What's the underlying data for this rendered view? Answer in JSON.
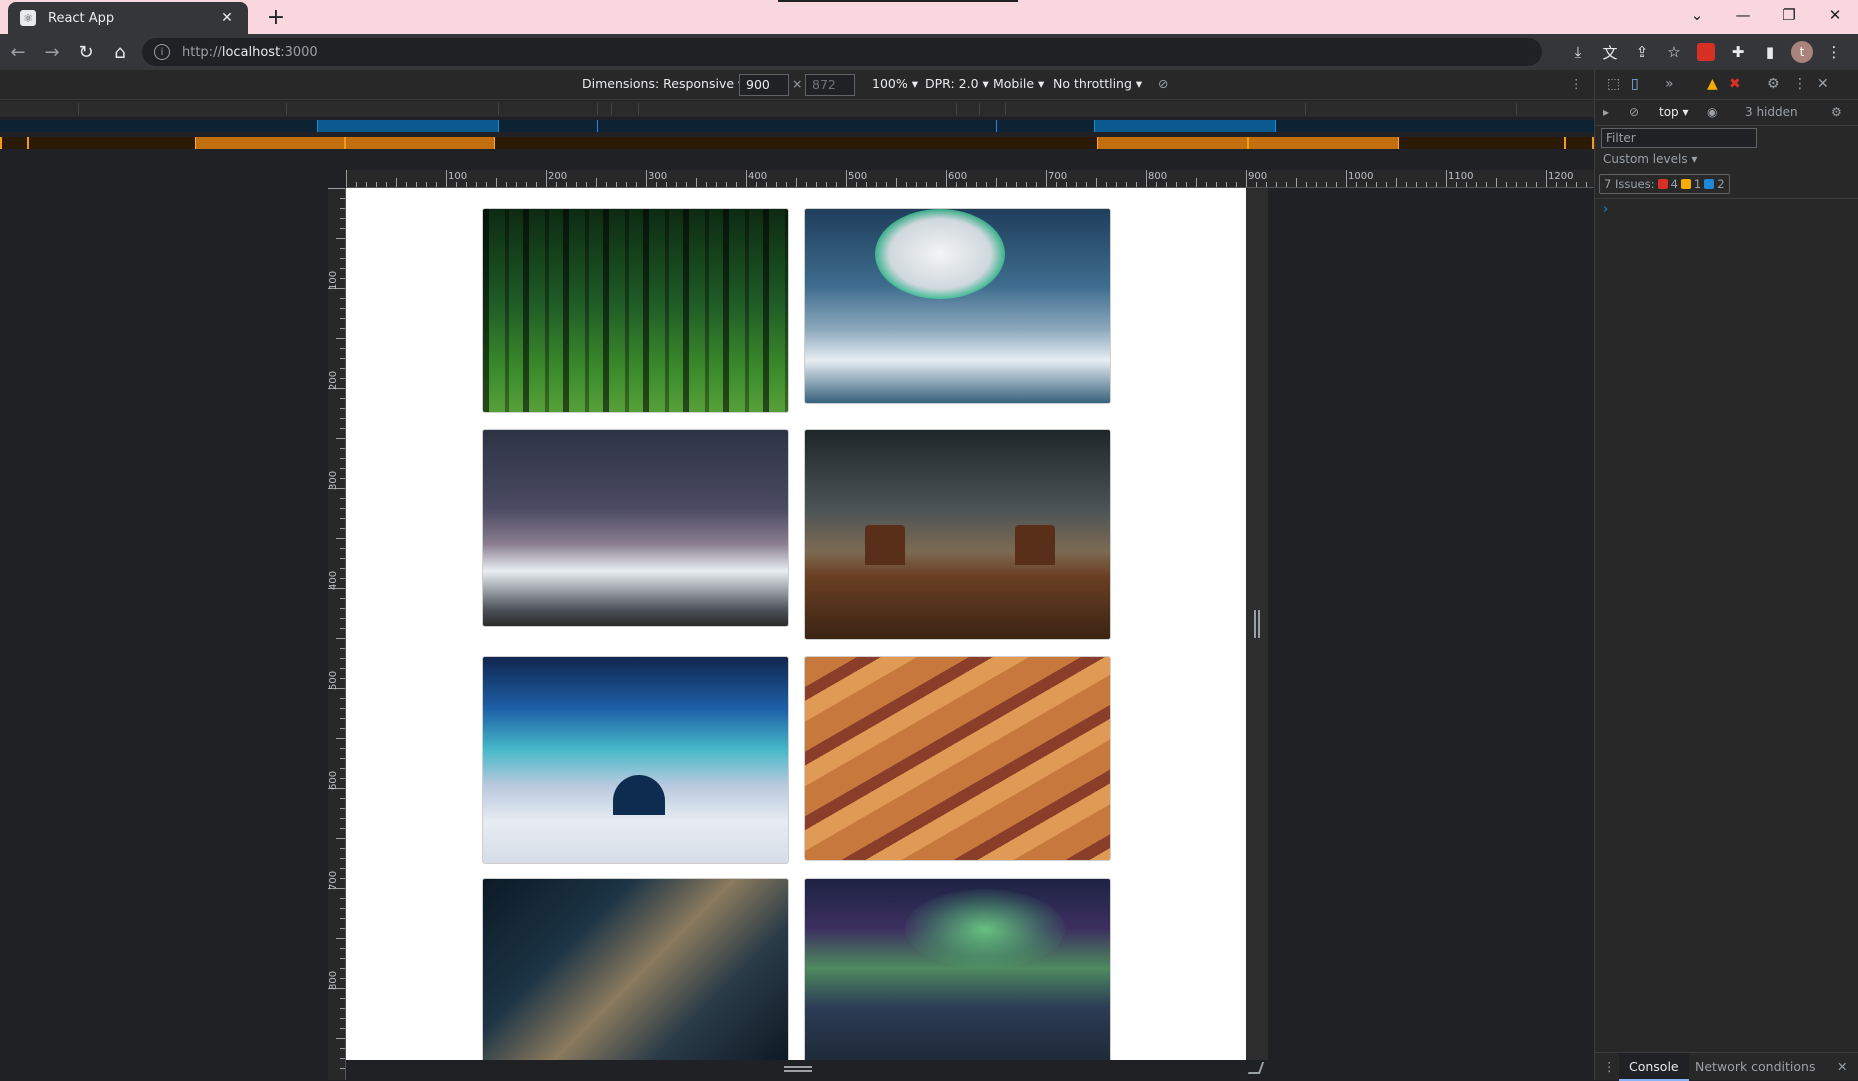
{
  "browser": {
    "tab_title": "React App",
    "tab_close": "✕",
    "new_tab": "+",
    "url_scheme": "http://",
    "url_host": "localhost",
    "url_port": ":3000"
  },
  "device_toolbar": {
    "dimensions": "Dimensions: Responsive ▾",
    "width": "900",
    "height": "872",
    "times": "×",
    "zoom": "100% ▾",
    "dpr": "DPR: 2.0 ▾",
    "device_type": "Mobile ▾",
    "throttling": "No throttling ▾"
  },
  "ruler": {
    "h_labels": [
      "100",
      "200",
      "300",
      "400",
      "500",
      "600",
      "700",
      "800",
      "900",
      "1000",
      "1100",
      "1200"
    ],
    "v_labels": [
      "100",
      "200",
      "300",
      "400",
      "500",
      "600",
      "700",
      "800"
    ]
  },
  "gallery": {
    "images": [
      {
        "name": "forest"
      },
      {
        "name": "aurora-snow-mountains"
      },
      {
        "name": "starry-snow-mountains"
      },
      {
        "name": "desert-lightning"
      },
      {
        "name": "aurora-igloo"
      },
      {
        "name": "sand-dunes"
      },
      {
        "name": "milky-way"
      },
      {
        "name": "aurora-lake"
      }
    ]
  },
  "devtools": {
    "more_tabs": "»",
    "context": "top ▾",
    "hidden": "3 hidden",
    "filter_placeholder": "Filter",
    "levels": "Custom levels ▾",
    "issues_label": "7 Issues:",
    "issues_errors": "4",
    "issues_warnings": "1",
    "issues_info": "2",
    "prompt": "›",
    "drawer_console": "Console",
    "drawer_network": "Network conditions",
    "drawer_close": "✕"
  },
  "colors": {
    "titlebar": "#f9d7df",
    "chrome_dark": "#35363a",
    "devtools_bg": "#282828",
    "accent_blue": "#8ab4f8",
    "error_red": "#d93025",
    "warning_yellow": "#f9ab00"
  }
}
